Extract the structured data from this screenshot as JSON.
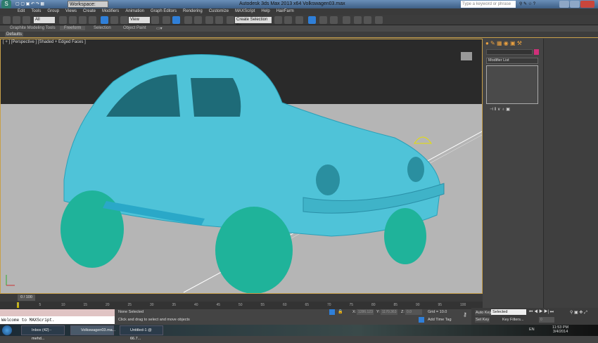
{
  "titlebar": {
    "workspace": "Workspace: Default",
    "title": "Autodesk 3ds Max 2013 x64    Volkswagen03.max",
    "search_placeholder": "Type a keyword or phrase"
  },
  "menu": [
    "Edit",
    "Tools",
    "Group",
    "Views",
    "Create",
    "Modifiers",
    "Animation",
    "Graph Editors",
    "Rendering",
    "Customize",
    "MAXScript",
    "Help",
    "HairFarm"
  ],
  "toolbar": {
    "selection_filter": "All",
    "ref_coord": "View",
    "named_selection": "Create Selection Se"
  },
  "ribbon": {
    "tabs": [
      "Graphite Modeling Tools",
      "Freeform",
      "Selection",
      "Object Paint"
    ],
    "active": "Freeform",
    "sub": "Defaults"
  },
  "viewport": {
    "label": "[ + ] [Perspective ] [Shaded + Edged Faces ]"
  },
  "command_panel": {
    "modifier_list": "Modifier List"
  },
  "timeline": {
    "slider": "0 / 100",
    "ticks": [
      "0",
      "5",
      "10",
      "15",
      "20",
      "25",
      "30",
      "35",
      "40",
      "45",
      "50",
      "55",
      "60",
      "65",
      "70",
      "75",
      "80",
      "85",
      "90",
      "95",
      "100"
    ]
  },
  "maxscript": {
    "output": "Welcome to MAXScript."
  },
  "status": {
    "selection": "None Selected",
    "prompt": "Click and drag to select and move objects",
    "x_label": "X:",
    "x": "1286.123",
    "y_label": "Y:",
    "y": "1170.363",
    "z_label": "Z:",
    "z": "0.0",
    "grid": "Grid = 10.0",
    "add_time_tag": "Add Time Tag"
  },
  "anim": {
    "auto_key": "Auto Key",
    "set_key": "Set Key",
    "key_mode": "Selected",
    "key_filters": "Key Filters...",
    "frame": "0"
  },
  "taskbar": {
    "items": [
      "Inbox (42) - mehd...",
      "Volkswagen03.ma...",
      "Untitled-1 @ 66.7..."
    ],
    "lang": "EN",
    "time": "11:53 PM",
    "date": "3/4/2014"
  }
}
